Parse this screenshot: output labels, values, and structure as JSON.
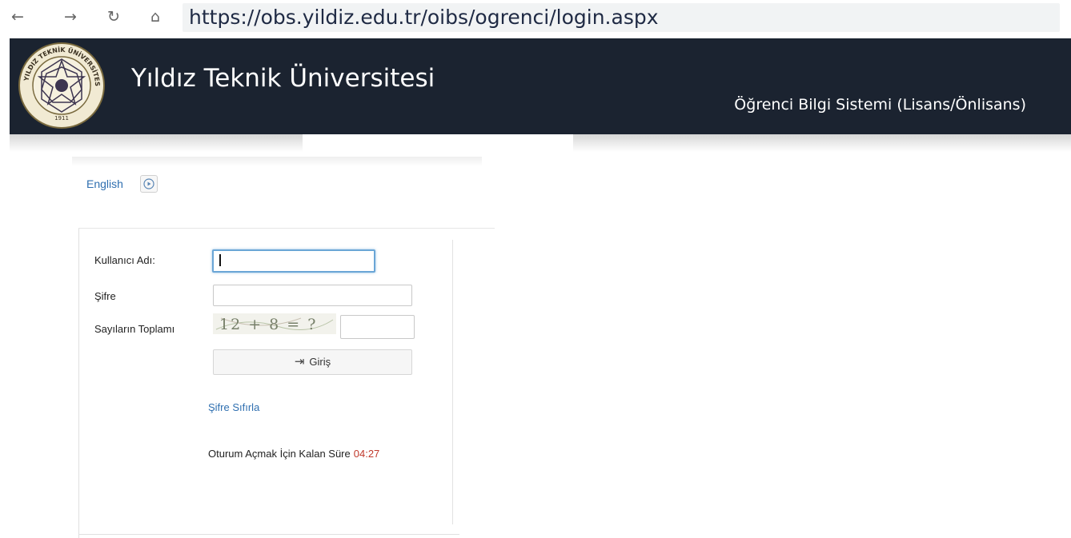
{
  "browser": {
    "url": "https://obs.yildiz.edu.tr/oibs/ogrenci/login.aspx",
    "back_icon": "arrow-left-icon",
    "forward_icon": "arrow-right-icon",
    "reload_icon": "reload-icon",
    "home_icon": "home-icon"
  },
  "header": {
    "university_name": "Yıldız Teknik Üniversitesi",
    "system_name": "Öğrenci Bilgi Sistemi (Lisans/Önlisans)",
    "logo_year": "1911",
    "logo_text": "YILDIZ TEKNİK ÜNİVERSİTESİ",
    "background": "#1b2330"
  },
  "language": {
    "link_label": "English"
  },
  "login_form": {
    "username_label": "Kullanıcı Adı:",
    "username_value": "",
    "password_label": "Şifre",
    "password_value": "",
    "captcha_label": "Sayıların Toplamı",
    "captcha_text": "12 + 8 = ?",
    "captcha_answer": "",
    "submit_label": "Giriş",
    "reset_password_link": "Şifre Sıfırla",
    "session_timer_label": "Oturum Açmak İçin Kalan Süre",
    "session_timer_value": "04:27"
  },
  "colors": {
    "link": "#2f6fb0",
    "timer": "#c0392b",
    "focus_border": "#6aa6d6"
  }
}
